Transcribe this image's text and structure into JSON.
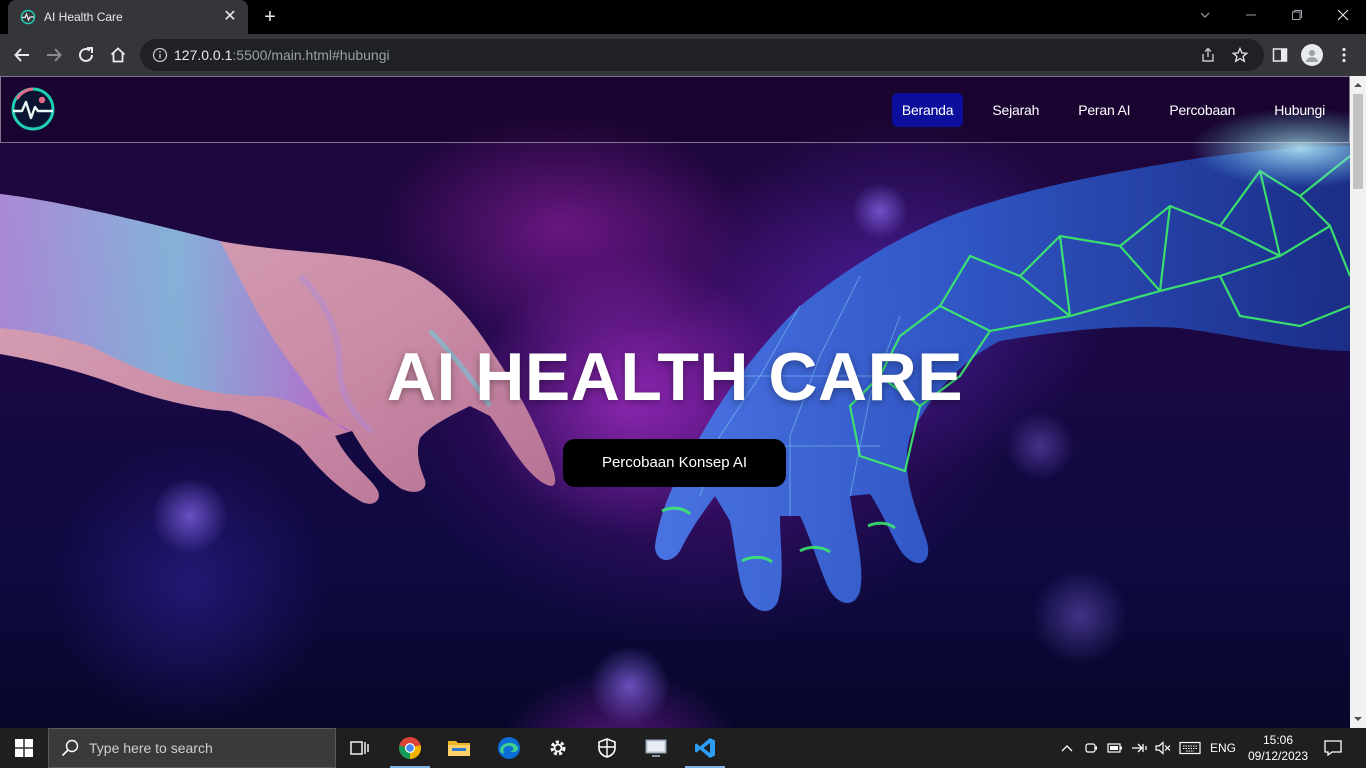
{
  "browser": {
    "tab_title": "AI Health Care",
    "url_host": "127.0.0.1",
    "url_rest": ":5500/main.html#hubungi"
  },
  "site": {
    "nav": [
      {
        "label": "Beranda",
        "active": true
      },
      {
        "label": "Sejarah",
        "active": false
      },
      {
        "label": "Peran AI",
        "active": false
      },
      {
        "label": "Percobaan",
        "active": false
      },
      {
        "label": "Hubungi",
        "active": false
      }
    ],
    "hero_title": "AI HEALTH CARE",
    "cta_label": "Percobaan Konsep AI",
    "colors": {
      "nav_active": "#0b0f9c",
      "cta_bg": "#000000",
      "logo_teal": "#1fd1b3",
      "logo_pink": "#e56b8a"
    }
  },
  "taskbar": {
    "search_placeholder": "Type here to search",
    "language": "ENG",
    "time": "15:06",
    "date": "09/12/2023"
  }
}
